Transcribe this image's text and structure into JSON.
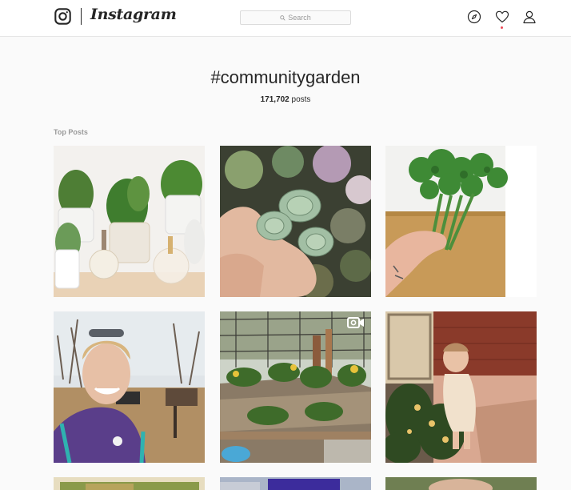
{
  "header": {
    "brand": "Instagram",
    "search_placeholder": "Search",
    "icons": [
      "instagram-glyph-icon",
      "compass-icon",
      "heart-icon",
      "profile-icon"
    ],
    "notification_color": "#ed4956"
  },
  "tag": {
    "name": "#communitygarden",
    "count": "171,702",
    "count_suffix": " posts"
  },
  "section": {
    "label": "Top Posts"
  },
  "posts": [
    {
      "subject": "potted herbs on shelf",
      "video": false
    },
    {
      "subject": "hand holding succulents",
      "video": false
    },
    {
      "subject": "hand holding broccolini on cutting board",
      "video": true
    },
    {
      "subject": "smiling woman selfie at trail",
      "video": false
    },
    {
      "subject": "raised garden beds",
      "video": true
    },
    {
      "subject": "toddler with tomato plants",
      "video": false
    },
    {
      "subject": "partial post",
      "video": false
    },
    {
      "subject": "partial post",
      "video": false
    },
    {
      "subject": "partial post",
      "video": false
    }
  ]
}
